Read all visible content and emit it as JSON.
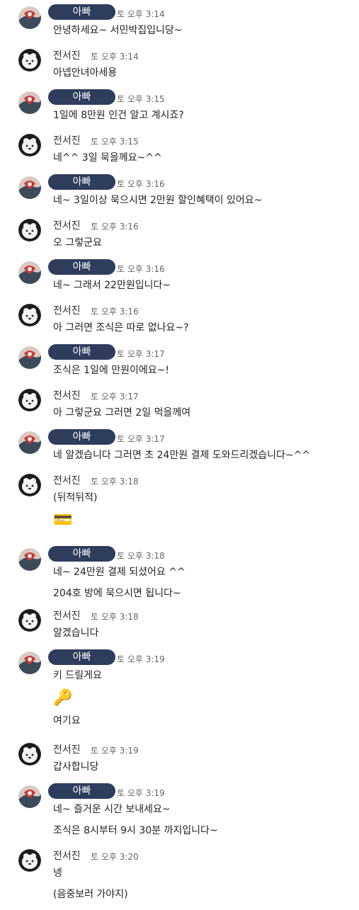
{
  "names": {
    "dad": "아빠",
    "son": "전서진"
  },
  "messages": [
    {
      "who": "dad",
      "time": "토 오후 3:14",
      "lines": [
        "안녕하세요~ 서민박집입니당~"
      ]
    },
    {
      "who": "son",
      "time": "토 오후 3:14",
      "lines": [
        "아넵안녀아세용"
      ]
    },
    {
      "who": "dad",
      "time": "토 오후 3:15",
      "lines": [
        "1일에 8만원 인건 알고 계시죠?"
      ]
    },
    {
      "who": "son",
      "time": "토 오후 3:15",
      "lines": [
        "네^^ 3일 묵을께요~^^"
      ]
    },
    {
      "who": "dad",
      "time": "토 오후 3:16",
      "lines": [
        "네~ 3일이상 묵으시면 2만원 할인혜택이 있어요~"
      ]
    },
    {
      "who": "son",
      "time": "토 오후 3:16",
      "lines": [
        "오 그렇군요"
      ]
    },
    {
      "who": "dad",
      "time": "토 오후 3:16",
      "lines": [
        "네~ 그래서 22만원입니다~"
      ]
    },
    {
      "who": "son",
      "time": "토 오후 3:16",
      "lines": [
        "아 그러면 조식은 따로 없나요~?"
      ]
    },
    {
      "who": "dad",
      "time": "토 오후 3:17",
      "lines": [
        "조식은 1일에 만원이에요~!"
      ]
    },
    {
      "who": "son",
      "time": "토 오후 3:17",
      "lines": [
        "아 그렇군요 그러면 2일 먹을께여"
      ]
    },
    {
      "who": "dad",
      "time": "토 오후 3:17",
      "lines": [
        "네 알겠습니다 그러면 초 24만원 결제  도와드리겠습니다~^^"
      ]
    },
    {
      "who": "son",
      "time": "토 오후 3:18",
      "lines": [
        "(뒤적뒤적)",
        "💳"
      ]
    },
    {
      "who": "dad",
      "time": "토 오후 3:18",
      "lines": [
        "네~ 24만원 결제 되셨어요 ^^",
        "204호 방에 묵으시면 됩니다~"
      ]
    },
    {
      "who": "son",
      "time": "토 오후 3:18",
      "lines": [
        "알겠습니다"
      ]
    },
    {
      "who": "dad",
      "time": "토 오후 3:19",
      "lines": [
        "키 드릴게요",
        "🔑",
        "여기요"
      ]
    },
    {
      "who": "son",
      "time": "토 오후 3:19",
      "lines": [
        "갑사합니당"
      ]
    },
    {
      "who": "dad",
      "time": "토 오후 3:19",
      "lines": [
        "네~ 즐거운 시간 보내세요~",
        "조식은 8시부터 9시 30분 까지입니다~"
      ]
    },
    {
      "who": "son",
      "time": "토 오후 3:20",
      "lines": [
        "넹",
        "(음중보러 가야지)"
      ]
    }
  ]
}
